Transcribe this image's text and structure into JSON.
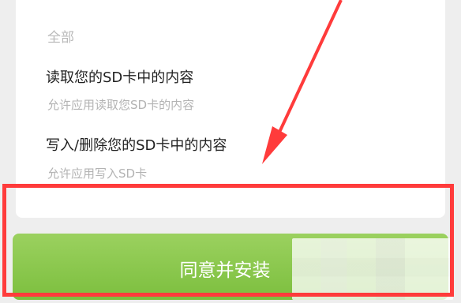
{
  "permissions": {
    "section_label": "全部",
    "items": [
      {
        "title": "读取您的SD卡中的内容",
        "description": "允许应用读取您SD卡的内容"
      },
      {
        "title": "写入/删除您的SD卡中的内容",
        "description": "允许应用写入SD卡"
      }
    ]
  },
  "install_button": {
    "label": "同意并安装"
  },
  "overlay": {
    "highlight_color": "#ff3b3b",
    "arrow_color": "#ff3b3b"
  }
}
